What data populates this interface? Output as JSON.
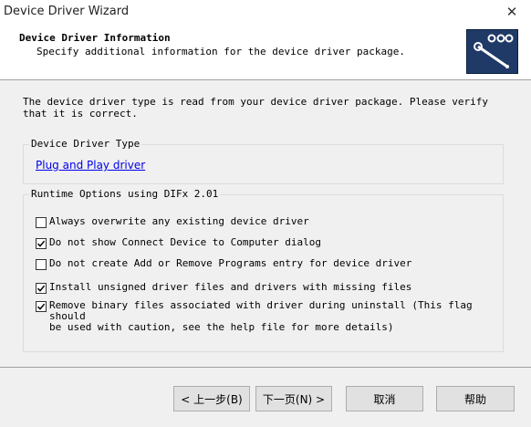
{
  "window": {
    "title": "Device Driver Wizard",
    "close_glyph": "✕"
  },
  "header": {
    "title": "Device Driver Information",
    "subtitle": "Specify additional information for the device driver package.",
    "logo_icon": "driver-wizard-logo",
    "logo_color": "#1f3a67"
  },
  "intro": {
    "text": "The device driver type is read from your device driver package. Please verify that it is correct."
  },
  "driver_type_group": {
    "legend": "Device Driver Type",
    "link_text": "Plug and Play driver"
  },
  "runtime_group": {
    "legend": "Runtime Options using DIFx 2.01",
    "options": [
      {
        "label": "Always overwrite any existing device driver",
        "checked": false
      },
      {
        "label": "Do not show Connect Device to Computer dialog",
        "checked": true
      },
      {
        "label": "Do not create Add or Remove Programs entry for device driver",
        "checked": false
      },
      {
        "label": "Install unsigned driver files and drivers with missing files",
        "checked": true
      },
      {
        "label": "Remove binary files associated with driver during uninstall (This flag should\nbe used with caution, see the help file for more details)",
        "checked": true
      }
    ]
  },
  "buttons": {
    "back": "< 上一步(B)",
    "next": "下一页(N) >",
    "cancel": "取消",
    "help": "帮助"
  }
}
